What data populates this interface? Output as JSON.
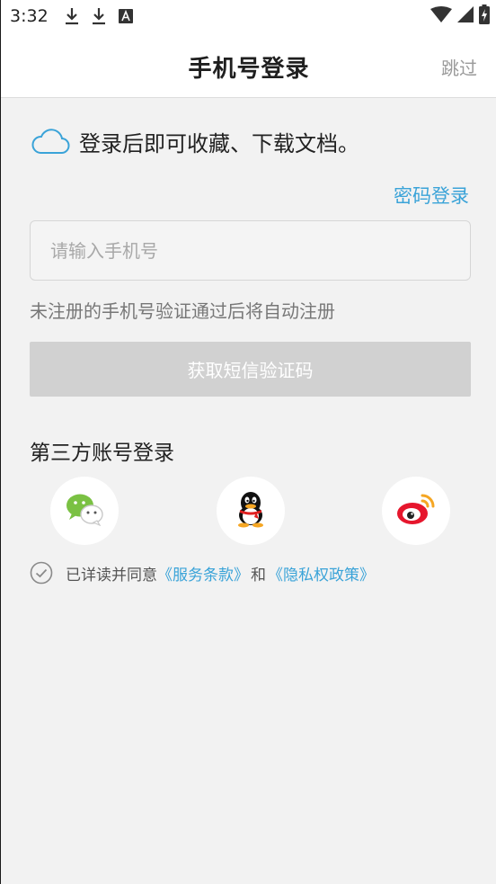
{
  "status_bar": {
    "time": "3:32",
    "icons": [
      "download-icon",
      "download-icon",
      "a-box-icon"
    ],
    "right_icons": [
      "wifi-icon",
      "signal-icon",
      "battery-icon"
    ]
  },
  "header": {
    "title": "手机号登录",
    "skip_label": "跳过"
  },
  "promo": {
    "icon": "cloud-icon",
    "text": "登录后即可收藏、下载文档。"
  },
  "password_login_label": "密码登录",
  "phone_input": {
    "placeholder": "请输入手机号",
    "value": ""
  },
  "register_hint": "未注册的手机号验证通过后将自动注册",
  "sms_button_label": "获取短信验证码",
  "third_party": {
    "title": "第三方账号登录",
    "providers": [
      "wechat-icon",
      "qq-icon",
      "weibo-icon"
    ]
  },
  "agreement": {
    "prefix": "已详读并同意",
    "terms": "《服务条款》",
    "and": "和",
    "privacy": "《隐私权政策》"
  },
  "colors": {
    "accent": "#3aa3d8",
    "button_disabled": "#d1d1d1",
    "background": "#f2f2f2",
    "wechat": "#7ac143",
    "weibo": "#e6162d"
  }
}
